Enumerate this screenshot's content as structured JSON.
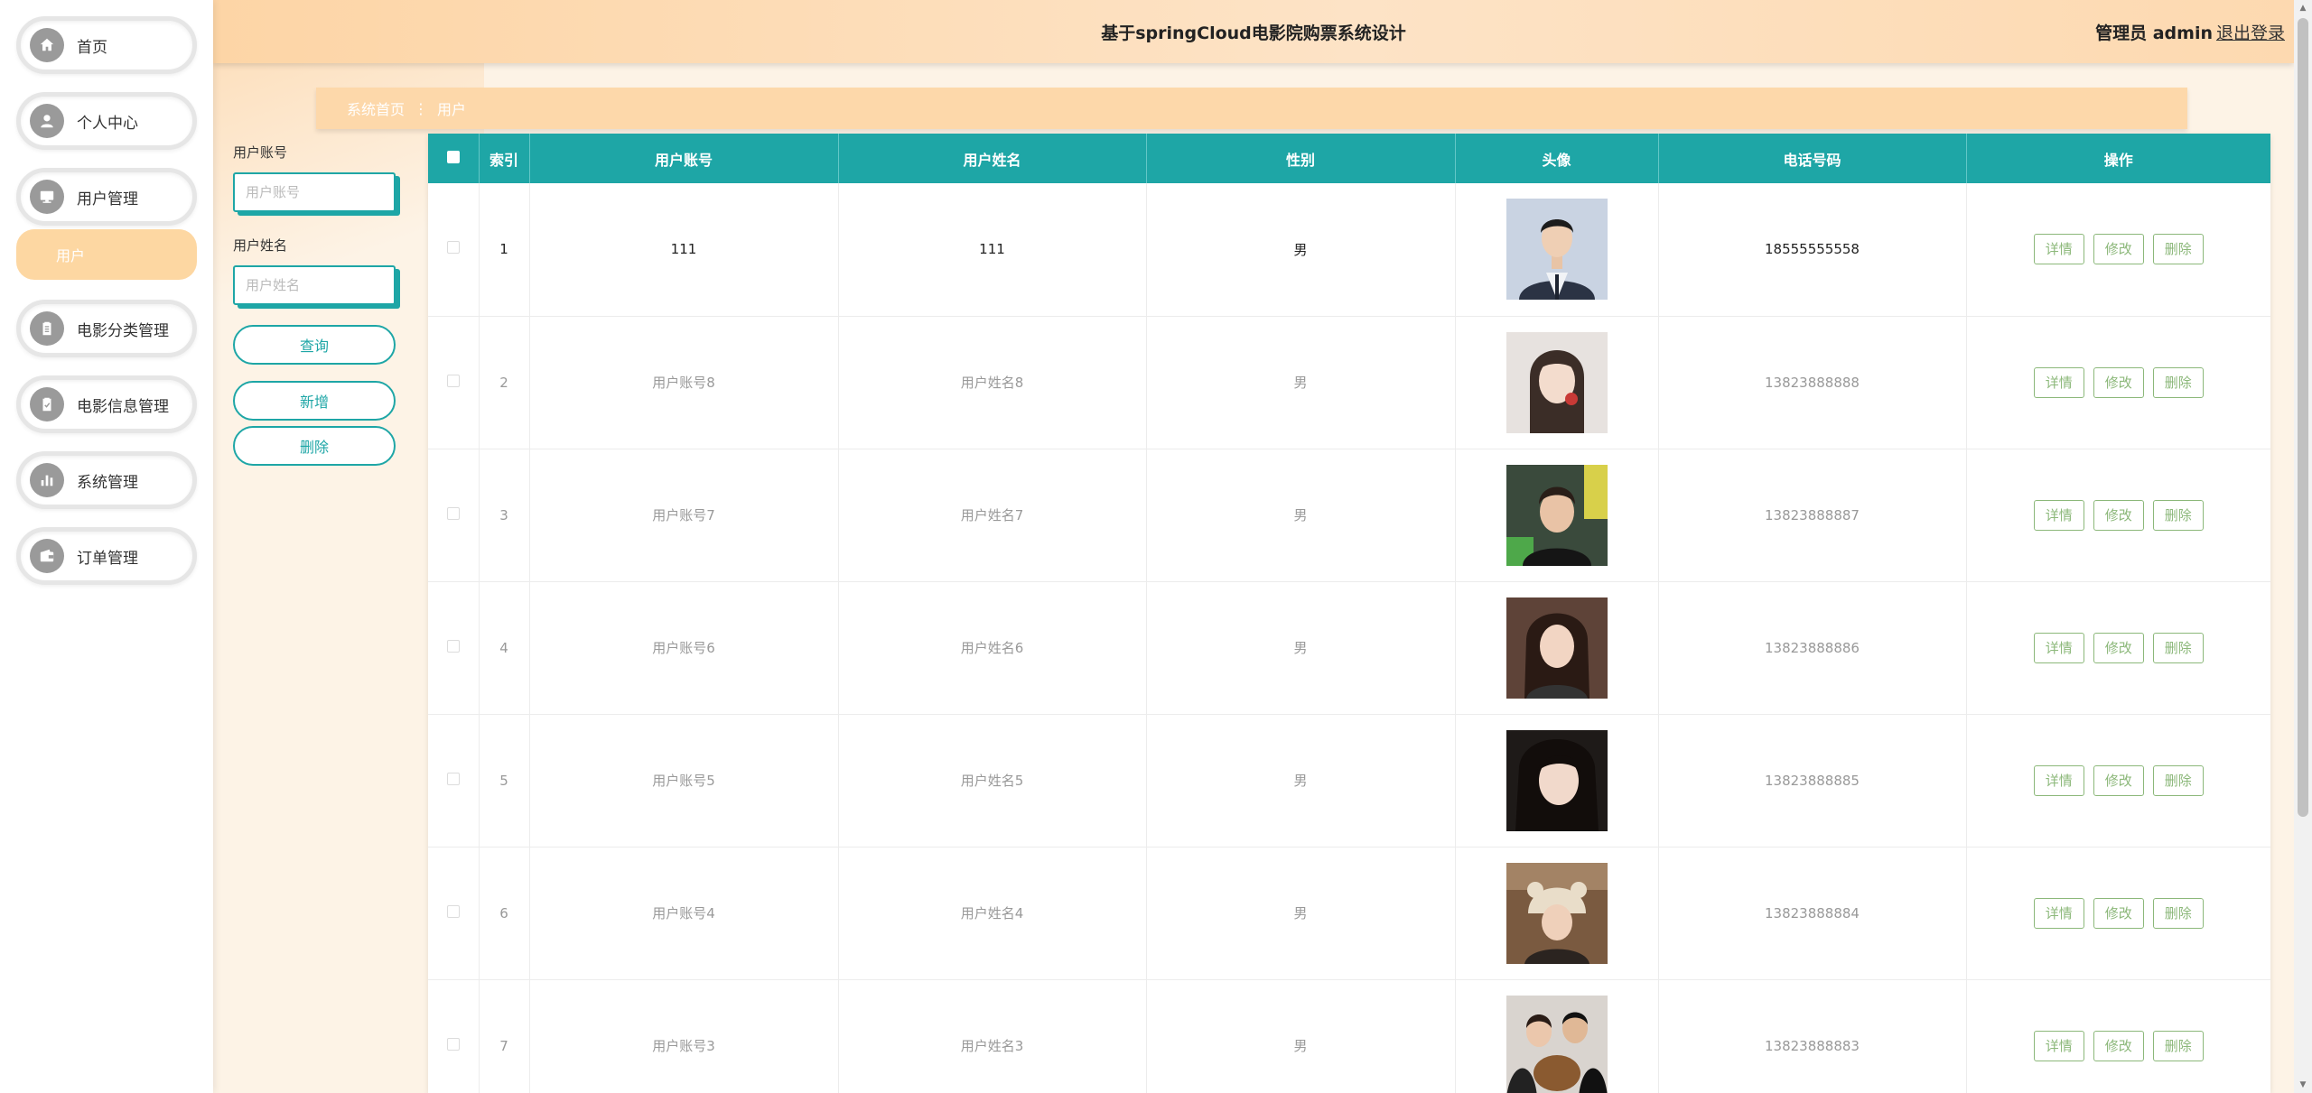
{
  "header": {
    "title": "基于springCloud电影院购票系统设计",
    "user": "管理员 admin",
    "logout": "退出登录"
  },
  "sidebar": {
    "items": [
      {
        "label": "首页",
        "icon": "home-icon"
      },
      {
        "label": "个人中心",
        "icon": "user-icon"
      },
      {
        "label": "用户管理",
        "icon": "monitor-icon"
      },
      {
        "label": "电影分类管理",
        "icon": "clipboard-icon"
      },
      {
        "label": "电影信息管理",
        "icon": "checklist-icon"
      },
      {
        "label": "系统管理",
        "icon": "bar-chart-icon"
      },
      {
        "label": "订单管理",
        "icon": "wallet-icon"
      }
    ],
    "active_sub": "用户"
  },
  "breadcrumb": {
    "home": "系统首页",
    "current": "用户"
  },
  "search": {
    "account_label": "用户账号",
    "account_placeholder": "用户账号",
    "name_label": "用户姓名",
    "name_placeholder": "用户姓名",
    "query_btn": "查询",
    "add_btn": "新增",
    "delete_btn": "删除"
  },
  "table": {
    "columns": [
      "索引",
      "用户账号",
      "用户姓名",
      "性别",
      "头像",
      "电话号码",
      "操作"
    ],
    "actions": [
      "详情",
      "修改",
      "删除"
    ],
    "rows": [
      {
        "index": "1",
        "account": "111",
        "name": "111",
        "gender": "男",
        "phone": "18555555558"
      },
      {
        "index": "2",
        "account": "用户账号8",
        "name": "用户姓名8",
        "gender": "男",
        "phone": "13823888888"
      },
      {
        "index": "3",
        "account": "用户账号7",
        "name": "用户姓名7",
        "gender": "男",
        "phone": "13823888887"
      },
      {
        "index": "4",
        "account": "用户账号6",
        "name": "用户姓名6",
        "gender": "男",
        "phone": "13823888886"
      },
      {
        "index": "5",
        "account": "用户账号5",
        "name": "用户姓名5",
        "gender": "男",
        "phone": "13823888885"
      },
      {
        "index": "6",
        "account": "用户账号4",
        "name": "用户姓名4",
        "gender": "男",
        "phone": "13823888884"
      },
      {
        "index": "7",
        "account": "用户账号3",
        "name": "用户姓名3",
        "gender": "男",
        "phone": "13823888883"
      }
    ]
  },
  "colors": {
    "accent": "#1ea6a6",
    "header_bg": "#fdd5a6",
    "active_menu": "#fdd7a2",
    "action_button": "#8cb87a"
  }
}
